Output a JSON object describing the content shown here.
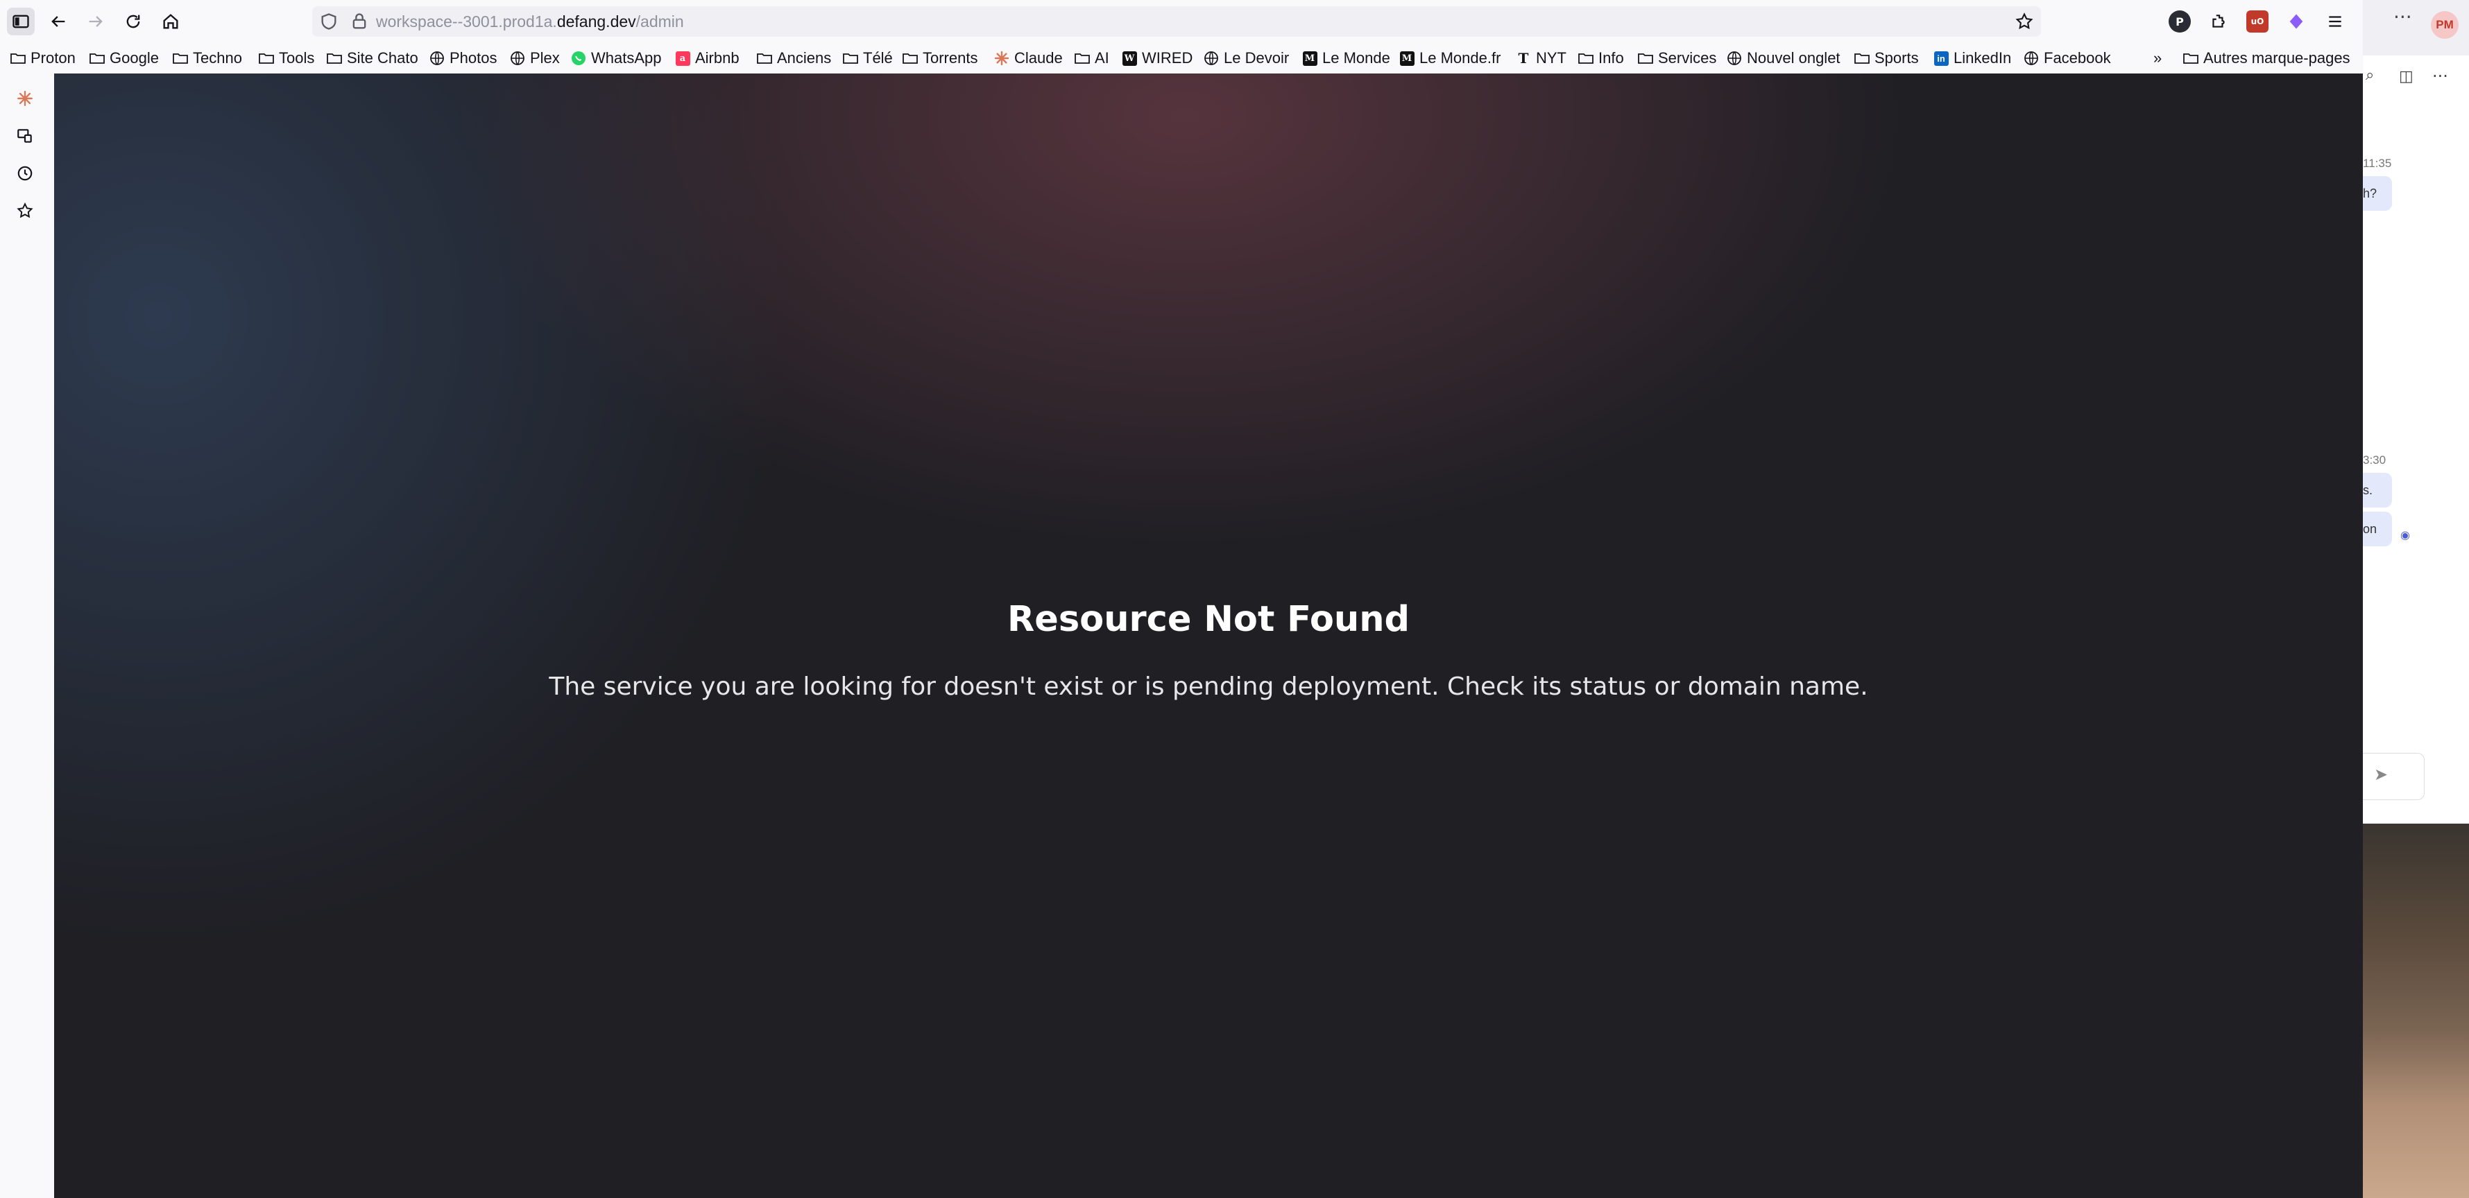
{
  "browser": {
    "url_prefix": "workspace--3001.prod1a.",
    "url_host": "defang.dev",
    "url_path": "/admin"
  },
  "bookmarks": [
    {
      "label": "Proton",
      "icon": "folder-icon"
    },
    {
      "label": "Google",
      "icon": "folder-icon"
    },
    {
      "label": "Techno",
      "icon": "folder-icon"
    },
    {
      "label": "Tools",
      "icon": "folder-icon"
    },
    {
      "label": "Site Chato",
      "icon": "folder-icon"
    },
    {
      "label": "Photos",
      "icon": "globe-icon"
    },
    {
      "label": "Plex",
      "icon": "globe-icon"
    },
    {
      "label": "WhatsApp",
      "icon": "whatsapp-icon"
    },
    {
      "label": "Airbnb",
      "icon": "airbnb-icon"
    },
    {
      "label": "Anciens",
      "icon": "folder-icon"
    },
    {
      "label": "Télé",
      "icon": "folder-icon"
    },
    {
      "label": "Torrents",
      "icon": "folder-icon"
    },
    {
      "label": "Claude",
      "icon": "claude-icon"
    },
    {
      "label": "AI",
      "icon": "folder-icon"
    },
    {
      "label": "WIRED",
      "icon": "wired-icon"
    },
    {
      "label": "Le Devoir",
      "icon": "globe-icon"
    },
    {
      "label": "Le Monde",
      "icon": "lemonde-icon"
    },
    {
      "label": "Le Monde.fr",
      "icon": "lemonde-icon"
    },
    {
      "label": "NYT",
      "icon": "nyt-icon"
    },
    {
      "label": "Info",
      "icon": "folder-icon"
    },
    {
      "label": "Services",
      "icon": "folder-icon"
    },
    {
      "label": "Nouvel onglet",
      "icon": "globe-icon"
    },
    {
      "label": "Sports",
      "icon": "folder-icon"
    },
    {
      "label": "LinkedIn",
      "icon": "linkedin-icon"
    },
    {
      "label": "Facebook",
      "icon": "globe-icon"
    }
  ],
  "other_bookmarks": "Autres marque-pages",
  "page": {
    "heading": "Resource Not Found",
    "message": "The service you are looking for doesn't exist or is pending deployment. Check its status or domain name."
  },
  "background_window": {
    "avatar": "PM",
    "time_1": "11:35",
    "bubble_1": "h?",
    "time_2": "3:30",
    "bubble_2": "s.",
    "bubble_3": "on"
  }
}
